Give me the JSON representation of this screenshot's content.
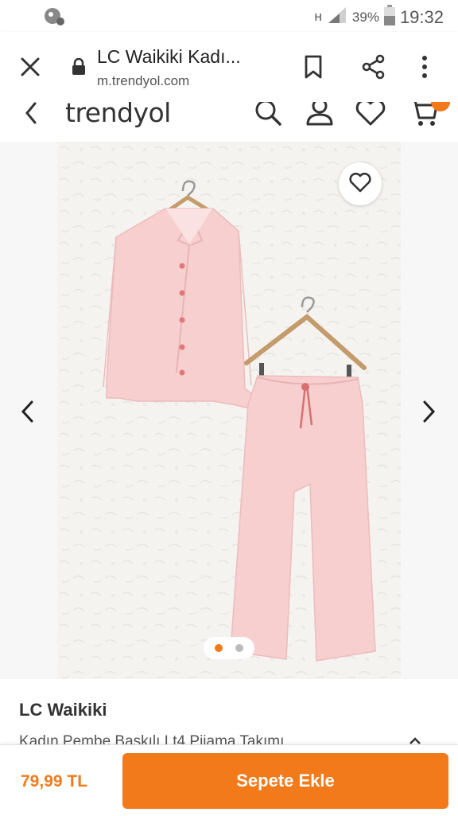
{
  "status": {
    "battery_percent": "39%",
    "time": "19:32",
    "network_label": "H"
  },
  "browser": {
    "title": "LC Waikiki Kadı...",
    "url": "m.trendyol.com",
    "icons": [
      "close-icon",
      "lock-icon",
      "bookmark-icon",
      "share-icon",
      "more-icon"
    ]
  },
  "site": {
    "logo": "trendyol",
    "icons": [
      "back-icon",
      "search-icon",
      "user-icon",
      "heart-icon",
      "cart-icon"
    ]
  },
  "gallery": {
    "image_alt": "pink pajama set",
    "total_images": 2,
    "active_index": 0
  },
  "product": {
    "brand": "LC Waikiki",
    "name": "Kadın Pembe Baskılı Lt4 Pijama Takımı"
  },
  "purchase": {
    "price": "79,99 TL",
    "add_to_cart_label": "Sepete Ekle"
  },
  "colors": {
    "accent": "#f27a1a",
    "garment": "#f7cfcf"
  }
}
